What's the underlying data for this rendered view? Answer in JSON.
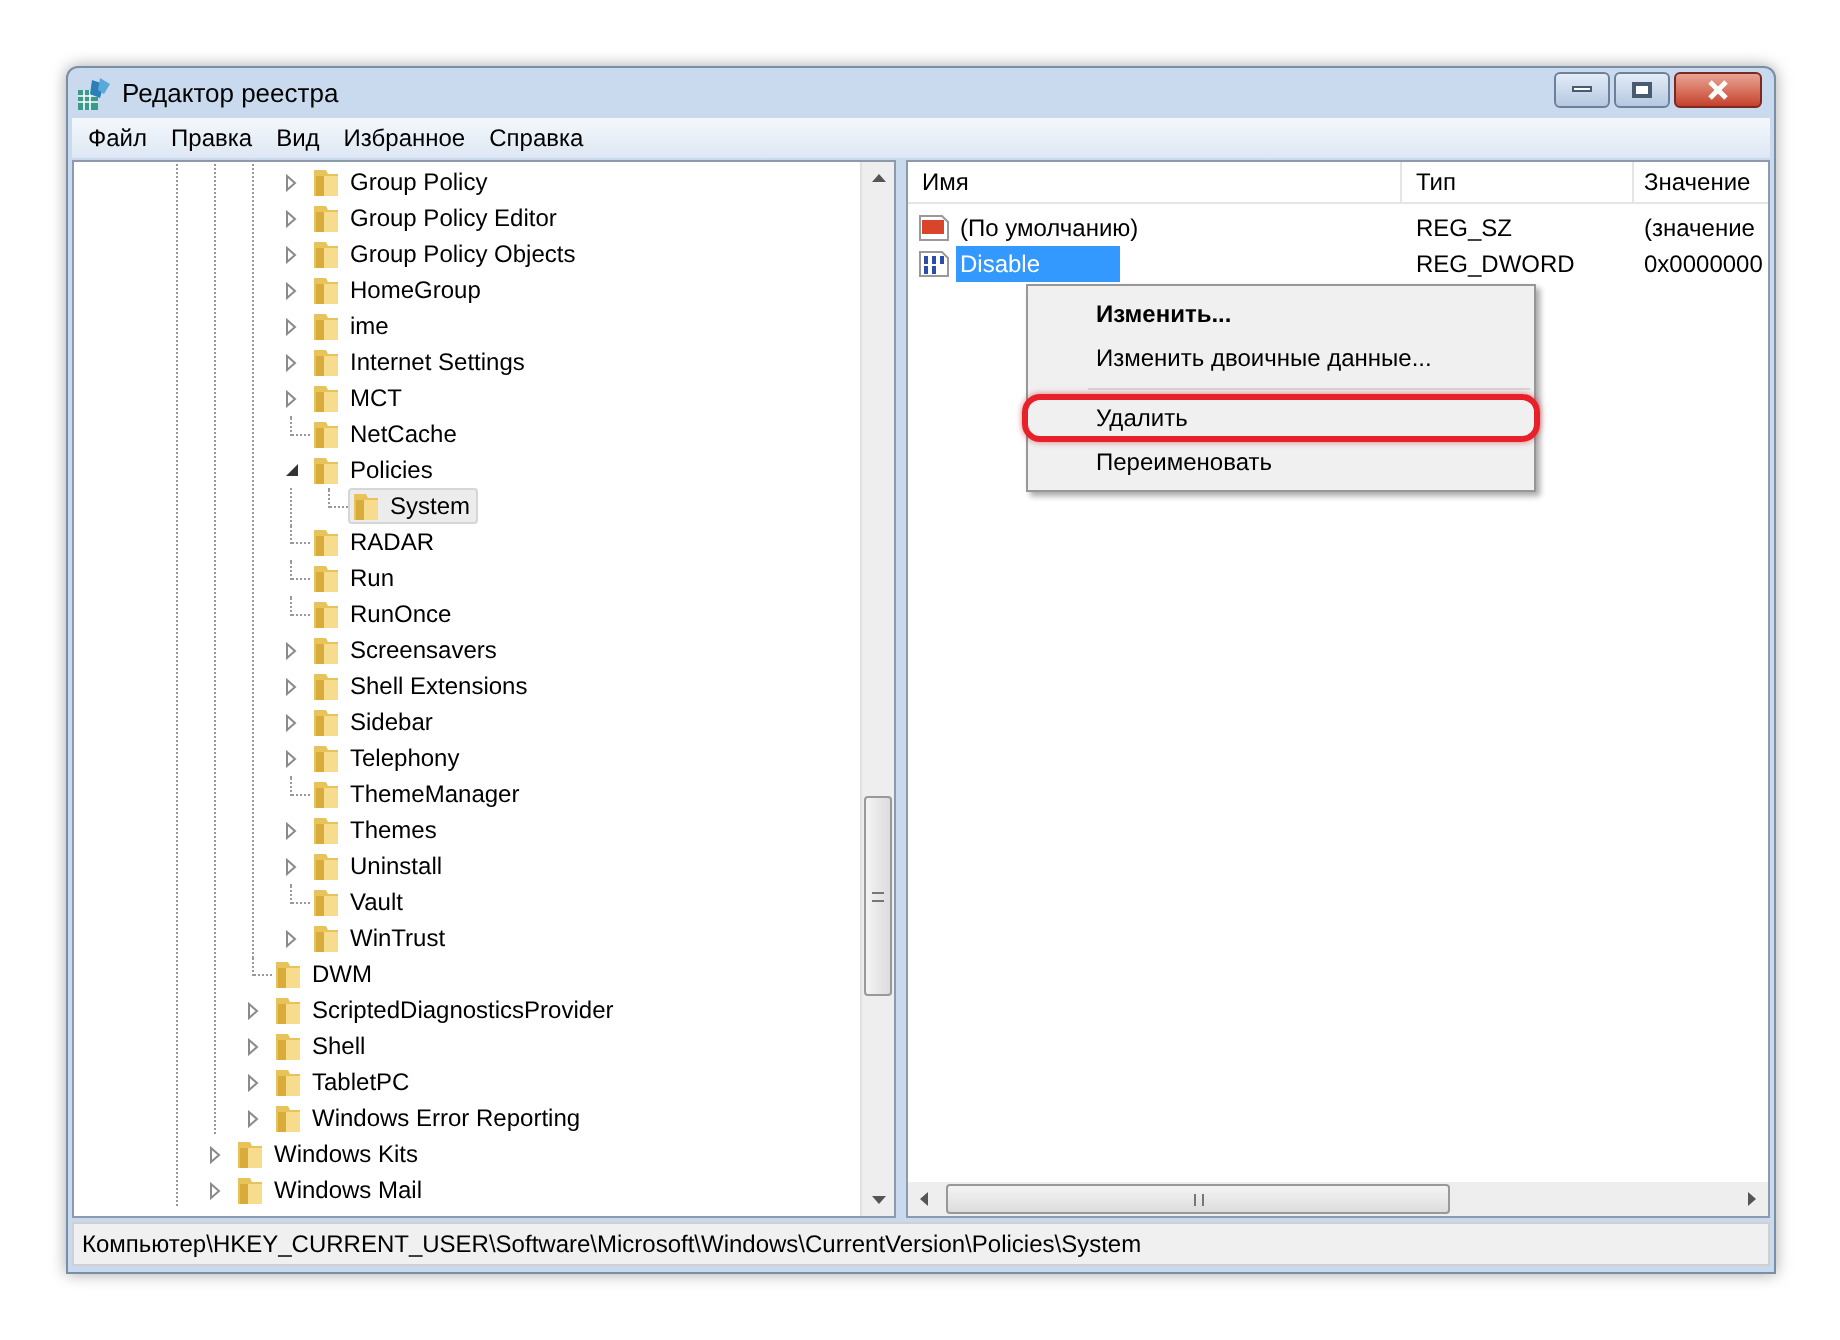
{
  "window": {
    "title": "Редактор реестра"
  },
  "menu": [
    "Файл",
    "Правка",
    "Вид",
    "Избранное",
    "Справка"
  ],
  "tree": [
    {
      "children": [
        {
          "children": [
            {
              "label": "Group Policy",
              "expandable": true,
              "expanded": false,
              "selected": false
            },
            {
              "label": "Group Policy Editor",
              "expandable": true,
              "expanded": false,
              "selected": false
            },
            {
              "label": "Group Policy Objects",
              "expandable": true,
              "expanded": false,
              "selected": false
            },
            {
              "label": "HomeGroup",
              "expandable": true,
              "expanded": false,
              "selected": false
            },
            {
              "label": "ime",
              "expandable": true,
              "expanded": false,
              "selected": false
            },
            {
              "label": "Internet Settings",
              "expandable": true,
              "expanded": false,
              "selected": false
            },
            {
              "label": "MCT",
              "expandable": true,
              "expanded": false,
              "selected": false
            },
            {
              "label": "NetCache",
              "expandable": false,
              "selected": false
            },
            {
              "label": "Policies",
              "expandable": true,
              "expanded": true,
              "selected": false,
              "children": [
                {
                  "label": "System",
                  "expandable": false,
                  "selected": true
                }
              ]
            },
            {
              "label": "RADAR",
              "expandable": false,
              "selected": false
            },
            {
              "label": "Run",
              "expandable": false,
              "selected": false
            },
            {
              "label": "RunOnce",
              "expandable": false,
              "selected": false
            },
            {
              "label": "Screensavers",
              "expandable": true,
              "expanded": false,
              "selected": false
            },
            {
              "label": "Shell Extensions",
              "expandable": true,
              "expanded": false,
              "selected": false
            },
            {
              "label": "Sidebar",
              "expandable": true,
              "expanded": false,
              "selected": false
            },
            {
              "label": "Telephony",
              "expandable": true,
              "expanded": false,
              "selected": false
            },
            {
              "label": "ThemeManager",
              "expandable": false,
              "selected": false
            },
            {
              "label": "Themes",
              "expandable": true,
              "expanded": false,
              "selected": false
            },
            {
              "label": "Uninstall",
              "expandable": true,
              "expanded": false,
              "selected": false
            },
            {
              "label": "Vault",
              "expandable": false,
              "selected": false
            },
            {
              "label": "WinTrust",
              "expandable": true,
              "expanded": false,
              "selected": false
            }
          ]
        },
        {
          "label": "DWM",
          "expandable": false,
          "selected": false
        },
        {
          "label": "ScriptedDiagnosticsProvider",
          "expandable": true,
          "expanded": false,
          "selected": false
        },
        {
          "label": "Shell",
          "expandable": true,
          "expanded": false,
          "selected": false
        },
        {
          "label": "TabletPC",
          "expandable": true,
          "expanded": false,
          "selected": false
        },
        {
          "label": "Windows Error Reporting",
          "expandable": true,
          "expanded": false,
          "selected": false
        }
      ]
    },
    {
      "label": "Windows Kits",
      "expandable": true,
      "expanded": false,
      "selected": false
    },
    {
      "label": "Windows Mail",
      "expandable": true,
      "expanded": false,
      "selected": false
    }
  ],
  "list": {
    "columns": [
      "Имя",
      "Тип",
      "Значение"
    ],
    "rows": [
      {
        "kind": "string",
        "name": "(По умолчанию)",
        "type": "REG_SZ",
        "value": "(значение",
        "selected": false
      },
      {
        "kind": "binary",
        "name": "Disable",
        "type": "REG_DWORD",
        "value": "0x0000000",
        "selected": true
      }
    ]
  },
  "context_menu": [
    {
      "label": "Изменить...",
      "default": true,
      "highlighted": false
    },
    {
      "label": "Изменить двоичные данные...",
      "default": false,
      "highlighted": false
    },
    {
      "kind": "separator"
    },
    {
      "label": "Удалить",
      "default": false,
      "highlighted": true
    },
    {
      "label": "Переименовать",
      "default": false,
      "highlighted": false
    }
  ],
  "status_bar": "Компьютер\\HKEY_CURRENT_USER\\Software\\Microsoft\\Windows\\CurrentVersion\\Policies\\System"
}
